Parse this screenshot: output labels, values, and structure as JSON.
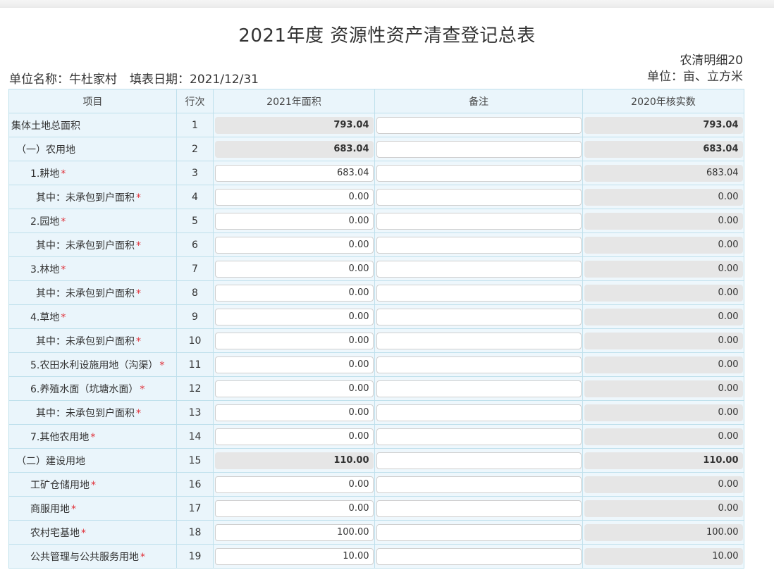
{
  "title": "2021年度 资源性资产清查登记总表",
  "meta": {
    "unit_name_label": "单位名称：",
    "unit_name": "牛杜家村",
    "fill_date_label": "填表日期：",
    "fill_date": "2021/12/31",
    "form_code": "农清明细20",
    "unit_label": "单位：亩、立方米"
  },
  "columns": {
    "item": "项目",
    "row_no": "行次",
    "area_2021": "2021年面积",
    "note": "备注",
    "verified_2020": "2020年核实数"
  },
  "rows": [
    {
      "name": "集体土地总面积",
      "level": 0,
      "required": false,
      "row_no": "1",
      "area_2021": "793.04",
      "area_2021_editable": false,
      "verified_2020": "793.04",
      "bold": true
    },
    {
      "name": "（一）农用地",
      "level": 1,
      "required": false,
      "row_no": "2",
      "area_2021": "683.04",
      "area_2021_editable": false,
      "verified_2020": "683.04",
      "bold": true
    },
    {
      "name": "1.耕地",
      "level": 2,
      "required": true,
      "row_no": "3",
      "area_2021": "683.04",
      "area_2021_editable": true,
      "verified_2020": "683.04",
      "bold": false
    },
    {
      "name": "其中：未承包到户面积",
      "level": 3,
      "required": true,
      "row_no": "4",
      "area_2021": "0.00",
      "area_2021_editable": true,
      "verified_2020": "0.00",
      "bold": false
    },
    {
      "name": "2.园地",
      "level": 2,
      "required": true,
      "row_no": "5",
      "area_2021": "0.00",
      "area_2021_editable": true,
      "verified_2020": "0.00",
      "bold": false
    },
    {
      "name": "其中：未承包到户面积",
      "level": 3,
      "required": true,
      "row_no": "6",
      "area_2021": "0.00",
      "area_2021_editable": true,
      "verified_2020": "0.00",
      "bold": false
    },
    {
      "name": "3.林地",
      "level": 2,
      "required": true,
      "row_no": "7",
      "area_2021": "0.00",
      "area_2021_editable": true,
      "verified_2020": "0.00",
      "bold": false
    },
    {
      "name": "其中：未承包到户面积",
      "level": 3,
      "required": true,
      "row_no": "8",
      "area_2021": "0.00",
      "area_2021_editable": true,
      "verified_2020": "0.00",
      "bold": false
    },
    {
      "name": "4.草地",
      "level": 2,
      "required": true,
      "row_no": "9",
      "area_2021": "0.00",
      "area_2021_editable": true,
      "verified_2020": "0.00",
      "bold": false
    },
    {
      "name": "其中：未承包到户面积",
      "level": 3,
      "required": true,
      "row_no": "10",
      "area_2021": "0.00",
      "area_2021_editable": true,
      "verified_2020": "0.00",
      "bold": false
    },
    {
      "name": "5.农田水利设施用地（沟渠）",
      "level": 2,
      "required": true,
      "row_no": "11",
      "area_2021": "0.00",
      "area_2021_editable": true,
      "verified_2020": "0.00",
      "bold": false
    },
    {
      "name": "6.养殖水面（坑塘水面）",
      "level": 2,
      "required": true,
      "row_no": "12",
      "area_2021": "0.00",
      "area_2021_editable": true,
      "verified_2020": "0.00",
      "bold": false
    },
    {
      "name": "其中：未承包到户面积",
      "level": 3,
      "required": true,
      "row_no": "13",
      "area_2021": "0.00",
      "area_2021_editable": true,
      "verified_2020": "0.00",
      "bold": false
    },
    {
      "name": "7.其他农用地",
      "level": 2,
      "required": true,
      "row_no": "14",
      "area_2021": "0.00",
      "area_2021_editable": true,
      "verified_2020": "0.00",
      "bold": false
    },
    {
      "name": "（二）建设用地",
      "level": 1,
      "required": false,
      "row_no": "15",
      "area_2021": "110.00",
      "area_2021_editable": false,
      "verified_2020": "110.00",
      "bold": true
    },
    {
      "name": "工矿仓储用地",
      "level": 2,
      "required": true,
      "row_no": "16",
      "area_2021": "0.00",
      "area_2021_editable": true,
      "verified_2020": "0.00",
      "bold": false
    },
    {
      "name": "商服用地",
      "level": 2,
      "required": true,
      "row_no": "17",
      "area_2021": "0.00",
      "area_2021_editable": true,
      "verified_2020": "0.00",
      "bold": false
    },
    {
      "name": "农村宅基地",
      "level": 2,
      "required": true,
      "row_no": "18",
      "area_2021": "100.00",
      "area_2021_editable": true,
      "verified_2020": "100.00",
      "bold": false
    },
    {
      "name": "公共管理与公共服务用地",
      "level": 2,
      "required": true,
      "row_no": "19",
      "area_2021": "10.00",
      "area_2021_editable": true,
      "verified_2020": "10.00",
      "bold": false
    }
  ],
  "colors": {
    "header_bg": "#eaf5fb",
    "border": "#bfe0ec",
    "readonly_bg": "#e6e6e6",
    "required_mark": "#e0323a"
  }
}
